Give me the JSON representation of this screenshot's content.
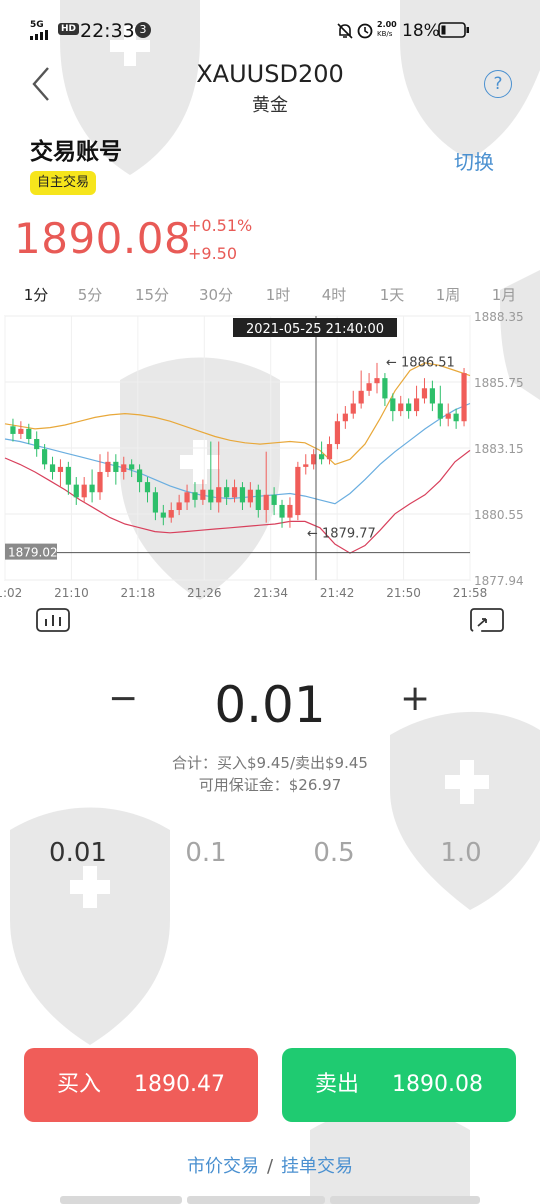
{
  "status_bar": {
    "network": "5G",
    "hd": "HD",
    "time": "22:33",
    "notification_count": "3",
    "speed_value": "2.00",
    "speed_unit": "KB/s",
    "battery": "18%"
  },
  "header": {
    "symbol": "XAUUSD200",
    "name": "黄金",
    "help_label": "?"
  },
  "account": {
    "title": "交易账号",
    "switch_label": "切换",
    "badge": "自主交易"
  },
  "quote": {
    "price": "1890.08",
    "change_pct": "+0.51%",
    "change_abs": "+9.50"
  },
  "timeframes": [
    "1分",
    "5分",
    "15分",
    "30分",
    "1时",
    "4时",
    "1天",
    "1周",
    "1月"
  ],
  "selected_timeframe": "1分",
  "chart_data": {
    "type": "candlestick",
    "crosshair_label": "2021-05-25 21:40:00",
    "y_ticks": [
      "1888.35",
      "1885.75",
      "1883.15",
      "1880.55",
      "1877.94"
    ],
    "x_ticks": [
      "21:02",
      "21:10",
      "21:18",
      "21:26",
      "21:34",
      "21:42",
      "21:50",
      "21:58"
    ],
    "ylim": [
      1877.94,
      1888.35
    ],
    "high_marker": "1886.51",
    "low_marker": "1879.77",
    "current_line_label": "1879.02",
    "current_line_value": 1879.02,
    "bollinger": {
      "upper": [
        1884.1,
        1884.0,
        1883.9,
        1883.95,
        1884.05,
        1884.2,
        1884.35,
        1884.45,
        1884.5,
        1884.45,
        1884.35,
        1884.2,
        1884.0,
        1883.8,
        1883.6,
        1883.45,
        1883.35,
        1883.3,
        1883.35,
        1883.4,
        1883.35,
        1883.05,
        1882.5,
        1882.7,
        1883.3,
        1884.3,
        1885.4,
        1886.2,
        1886.5,
        1886.4,
        1886.2,
        1886.0
      ],
      "middle": [
        1883.5,
        1883.4,
        1883.25,
        1883.1,
        1882.95,
        1882.8,
        1882.65,
        1882.5,
        1882.35,
        1882.15,
        1881.9,
        1881.65,
        1881.45,
        1881.3,
        1881.2,
        1881.15,
        1881.2,
        1881.25,
        1881.3,
        1881.35,
        1881.25,
        1881.1,
        1880.95,
        1881.35,
        1881.9,
        1882.5,
        1883.0,
        1883.45,
        1883.9,
        1884.3,
        1884.65,
        1884.9
      ],
      "lower": [
        1882.75,
        1882.5,
        1882.2,
        1881.85,
        1881.5,
        1881.1,
        1880.75,
        1880.4,
        1880.15,
        1880.0,
        1879.85,
        1879.8,
        1879.85,
        1879.9,
        1879.95,
        1880.0,
        1880.05,
        1880.1,
        1880.15,
        1880.25,
        1880.25,
        1880.0,
        1879.35,
        1879.0,
        1879.3,
        1879.9,
        1880.55,
        1880.95,
        1881.3,
        1881.85,
        1882.6,
        1883.05
      ]
    },
    "candles": [
      [
        1884.0,
        1883.7,
        1884.3,
        1883.4
      ],
      [
        1883.7,
        1883.9,
        1884.2,
        1883.5
      ],
      [
        1883.9,
        1883.5,
        1884.1,
        1883.3
      ],
      [
        1883.5,
        1883.1,
        1883.8,
        1882.8
      ],
      [
        1883.1,
        1882.5,
        1883.3,
        1882.3
      ],
      [
        1882.5,
        1882.2,
        1882.8,
        1881.9
      ],
      [
        1882.2,
        1882.4,
        1882.7,
        1881.6
      ],
      [
        1882.4,
        1881.7,
        1882.6,
        1881.3
      ],
      [
        1881.7,
        1881.2,
        1882.0,
        1880.9
      ],
      [
        1881.2,
        1881.7,
        1882.0,
        1881.0
      ],
      [
        1881.7,
        1881.4,
        1882.3,
        1881.0
      ],
      [
        1881.4,
        1882.2,
        1882.9,
        1881.1
      ],
      [
        1882.2,
        1882.6,
        1883.0,
        1882.0
      ],
      [
        1882.6,
        1882.2,
        1882.9,
        1881.7
      ],
      [
        1882.2,
        1882.5,
        1882.8,
        1881.9
      ],
      [
        1882.5,
        1882.3,
        1882.7,
        1882.0
      ],
      [
        1882.3,
        1881.8,
        1882.5,
        1881.4
      ],
      [
        1881.8,
        1881.4,
        1882.0,
        1881.0
      ],
      [
        1881.4,
        1880.6,
        1881.6,
        1880.3
      ],
      [
        1880.6,
        1880.4,
        1880.9,
        1880.1
      ],
      [
        1880.4,
        1880.7,
        1881.0,
        1880.2
      ],
      [
        1880.7,
        1881.0,
        1881.3,
        1880.5
      ],
      [
        1881.0,
        1881.4,
        1881.7,
        1880.7
      ],
      [
        1881.4,
        1881.1,
        1881.8,
        1880.8
      ],
      [
        1881.1,
        1881.5,
        1881.9,
        1880.9
      ],
      [
        1881.5,
        1881.0,
        1883.4,
        1880.7
      ],
      [
        1881.0,
        1881.6,
        1883.4,
        1880.6
      ],
      [
        1881.6,
        1881.2,
        1881.9,
        1880.9
      ],
      [
        1881.2,
        1881.6,
        1881.9,
        1881.0
      ],
      [
        1881.6,
        1881.0,
        1881.8,
        1880.7
      ],
      [
        1881.0,
        1881.5,
        1881.8,
        1880.8
      ],
      [
        1881.5,
        1880.7,
        1881.7,
        1880.4
      ],
      [
        1880.7,
        1881.3,
        1883.0,
        1880.2
      ],
      [
        1881.3,
        1880.9,
        1881.6,
        1880.5
      ],
      [
        1880.9,
        1880.4,
        1881.1,
        1880.0
      ],
      [
        1880.4,
        1880.9,
        1881.2,
        1880.0
      ],
      [
        1880.5,
        1882.4,
        1882.6,
        1880.3
      ],
      [
        1882.4,
        1882.5,
        1882.9,
        1882.1
      ],
      [
        1882.5,
        1882.9,
        1883.1,
        1882.3
      ],
      [
        1882.9,
        1882.7,
        1883.4,
        1882.5
      ],
      [
        1882.7,
        1883.3,
        1883.6,
        1882.5
      ],
      [
        1883.3,
        1884.2,
        1884.5,
        1883.1
      ],
      [
        1884.2,
        1884.5,
        1884.8,
        1883.9
      ],
      [
        1884.5,
        1884.9,
        1885.4,
        1884.3
      ],
      [
        1884.9,
        1885.4,
        1886.2,
        1884.7
      ],
      [
        1885.4,
        1885.7,
        1886.1,
        1885.2
      ],
      [
        1885.7,
        1885.9,
        1886.5,
        1885.3
      ],
      [
        1885.9,
        1885.1,
        1886.1,
        1884.8
      ],
      [
        1885.1,
        1884.6,
        1885.3,
        1884.2
      ],
      [
        1884.6,
        1884.9,
        1885.2,
        1884.4
      ],
      [
        1884.9,
        1884.6,
        1885.1,
        1884.3
      ],
      [
        1884.6,
        1885.1,
        1885.6,
        1884.4
      ],
      [
        1885.1,
        1885.5,
        1885.9,
        1884.9
      ],
      [
        1885.5,
        1884.9,
        1885.8,
        1884.6
      ],
      [
        1884.9,
        1884.3,
        1885.6,
        1884.0
      ],
      [
        1884.3,
        1884.5,
        1884.9,
        1884.0
      ],
      [
        1884.5,
        1884.2,
        1884.7,
        1883.9
      ],
      [
        1884.2,
        1886.1,
        1886.3,
        1884.0
      ]
    ]
  },
  "amount": {
    "minus": "−",
    "value": "0.01",
    "plus": "+",
    "total_line": "合计：买入$9.45/卖出$9.45",
    "margin_line": "可用保证金：$26.97"
  },
  "quick_lots": [
    "0.01",
    "0.1",
    "0.5",
    "1.0"
  ],
  "selected_lot": "0.01",
  "buy": {
    "label": "买入",
    "price": "1890.47",
    "color": "#f05d59"
  },
  "sell": {
    "label": "卖出",
    "price": "1890.08",
    "color": "#1fcb71"
  },
  "trade_modes": {
    "market": "市价交易",
    "separator": "/",
    "pending": "挂单交易"
  },
  "colors": {
    "up": "#f05d59",
    "down": "#2dbf6a",
    "accent": "#4a90d0",
    "badge": "#f6e51c"
  }
}
